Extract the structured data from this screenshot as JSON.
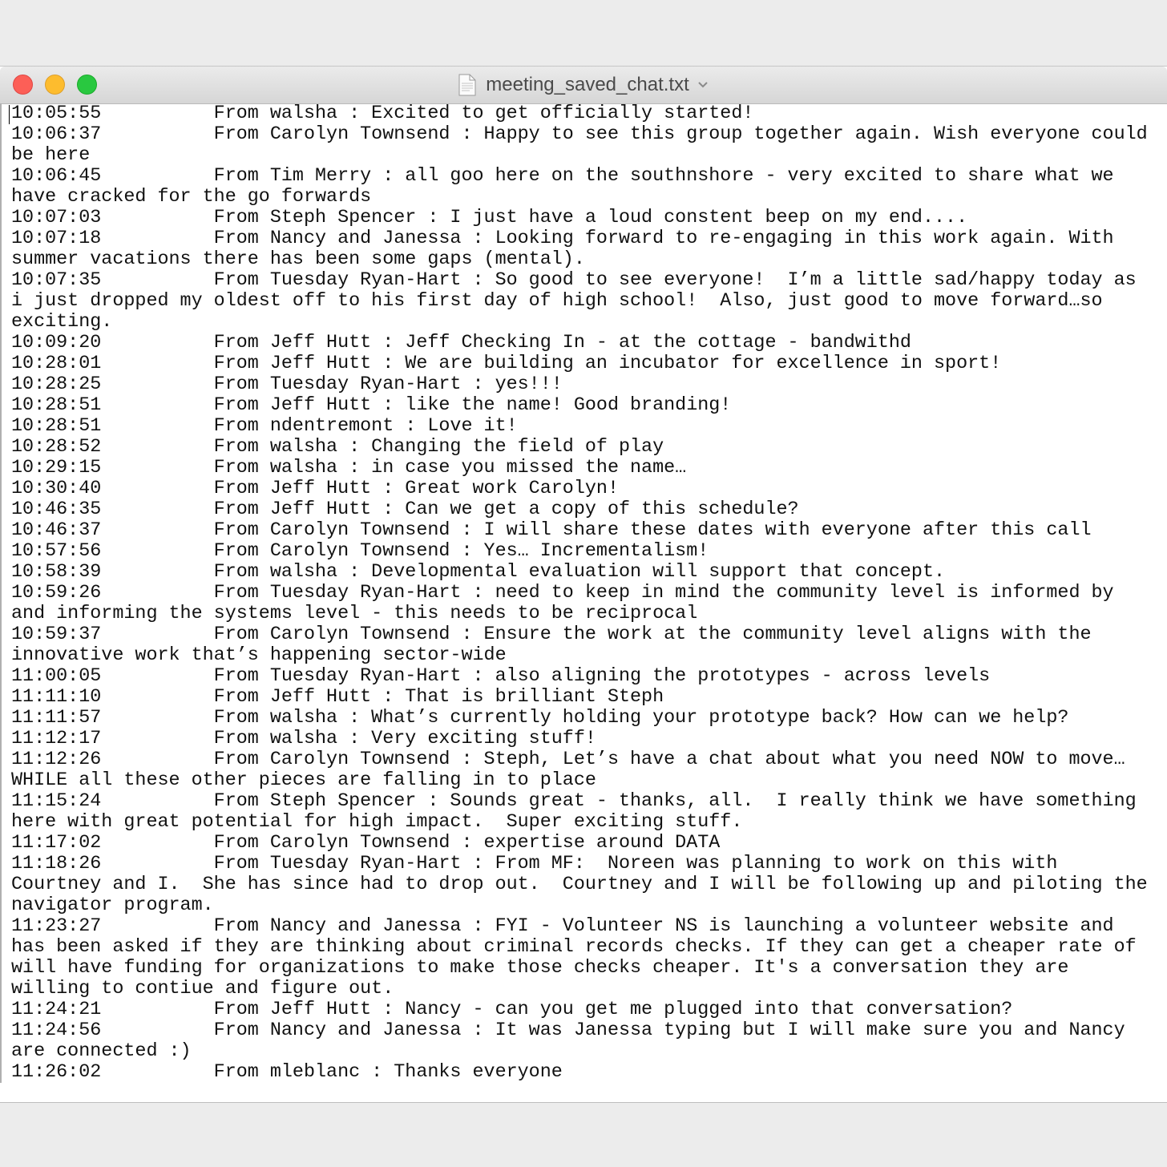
{
  "window": {
    "title": "meeting_saved_chat.txt"
  },
  "document": {
    "lines": [
      "10:05:55\t From walsha : Excited to get officially started!",
      "10:06:37\t From Carolyn Townsend : Happy to see this group together again. Wish everyone could be here",
      "10:06:45\t From Tim Merry : all goo here on the southnshore - very excited to share what we have cracked for the go forwards",
      "10:07:03\t From Steph Spencer : I just have a loud constent beep on my end....",
      "10:07:18\t From Nancy and Janessa : Looking forward to re-engaging in this work again. With summer vacations there has been some gaps (mental).",
      "10:07:35\t From Tuesday Ryan-Hart : So good to see everyone!  I’m a little sad/happy today as i just dropped my oldest off to his first day of high school!  Also, just good to move forward…so exciting.",
      "10:09:20\t From Jeff Hutt : Jeff Checking In - at the cottage - bandwithd",
      "10:28:01\t From Jeff Hutt : We are building an incubator for excellence in sport!",
      "10:28:25\t From Tuesday Ryan-Hart : yes!!!",
      "10:28:51\t From Jeff Hutt : like the name! Good branding!",
      "10:28:51\t From ndentremont : Love it!",
      "10:28:52\t From walsha : Changing the field of play",
      "10:29:15\t From walsha : in case you missed the name…",
      "10:30:40\t From Jeff Hutt : Great work Carolyn!",
      "10:46:35\t From Jeff Hutt : Can we get a copy of this schedule?",
      "10:46:37\t From Carolyn Townsend : I will share these dates with everyone after this call",
      "10:57:56\t From Carolyn Townsend : Yes… Incrementalism!",
      "10:58:39\t From walsha : Developmental evaluation will support that concept.",
      "10:59:26\t From Tuesday Ryan-Hart : need to keep in mind the community level is informed by and informing the systems level - this needs to be reciprocal",
      "10:59:37\t From Carolyn Townsend : Ensure the work at the community level aligns with the innovative work that’s happening sector-wide",
      "11:00:05\t From Tuesday Ryan-Hart : also aligning the prototypes - across levels",
      "11:11:10\t From Jeff Hutt : That is brilliant Steph",
      "11:11:57\t From walsha : What’s currently holding your prototype back? How can we help?",
      "11:12:17\t From walsha : Very exciting stuff!",
      "11:12:26\t From Carolyn Townsend : Steph, Let’s have a chat about what you need NOW to move… WHILE all these other pieces are falling in to place",
      "11:15:24\t From Steph Spencer : Sounds great - thanks, all.  I really think we have something here with great potential for high impact.  Super exciting stuff.",
      "11:17:02\t From Carolyn Townsend : expertise around DATA",
      "11:18:26\t From Tuesday Ryan-Hart : From MF:  Noreen was planning to work on this with Courtney and I.  She has since had to drop out.  Courtney and I will be following up and piloting the navigator program.",
      "11:23:27\t From Nancy and Janessa : FYI - Volunteer NS is launching a volunteer website and has been asked if they are thinking about criminal records checks. If they can get a cheaper rate of will have funding for organizations to make those checks cheaper. It's a conversation they are willing to contiue and figure out.",
      "11:24:21\t From Jeff Hutt : Nancy - can you get me plugged into that conversation?",
      "11:24:56\t From Nancy and Janessa : It was Janessa typing but I will make sure you and Nancy are connected :)",
      "11:26:02\t From mleblanc : Thanks everyone"
    ]
  },
  "colors": {
    "close": "#fc5f57",
    "minimize": "#fdbc2e",
    "maximize": "#29c840"
  },
  "icons": {
    "file": "document-icon",
    "dropdown": "chevron-down-icon"
  }
}
